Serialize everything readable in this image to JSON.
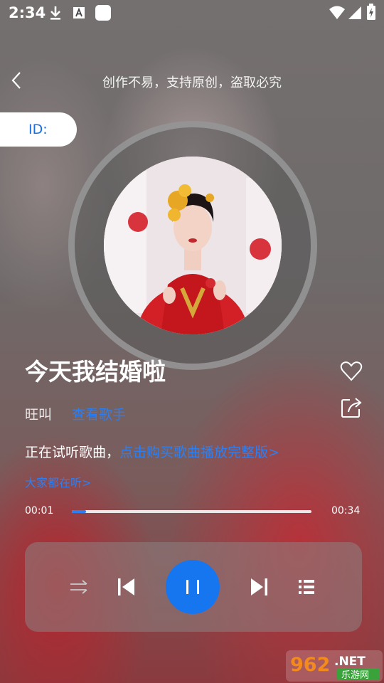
{
  "status_bar": {
    "time": "2:34"
  },
  "header": {
    "title": "创作不易，支持原创，盗取必究"
  },
  "id_badge": {
    "label": "ID:"
  },
  "song": {
    "title": "今天我结婚啦",
    "artist": "旺叫",
    "view_singer_label": "查看歌手"
  },
  "trial": {
    "text": "正在试听歌曲，",
    "link": "点击购买歌曲播放完整版>"
  },
  "everyone_listening": "大家都在听>",
  "playback": {
    "current_time": "00:01",
    "total_time": "00:34",
    "progress": 0.06
  },
  "watermark": {
    "brand": "962",
    "suffix": ".NET",
    "site": "乐游网"
  },
  "colors": {
    "accent": "#1576f0",
    "link": "#2c7ff2"
  },
  "icons": [
    "download-icon",
    "a-icon",
    "app-square-icon",
    "wifi-icon",
    "signal-icon",
    "battery-icon",
    "back-icon",
    "heart-icon",
    "share-icon",
    "shuffle-icon",
    "previous-icon",
    "pause-icon",
    "next-icon",
    "playlist-icon"
  ]
}
